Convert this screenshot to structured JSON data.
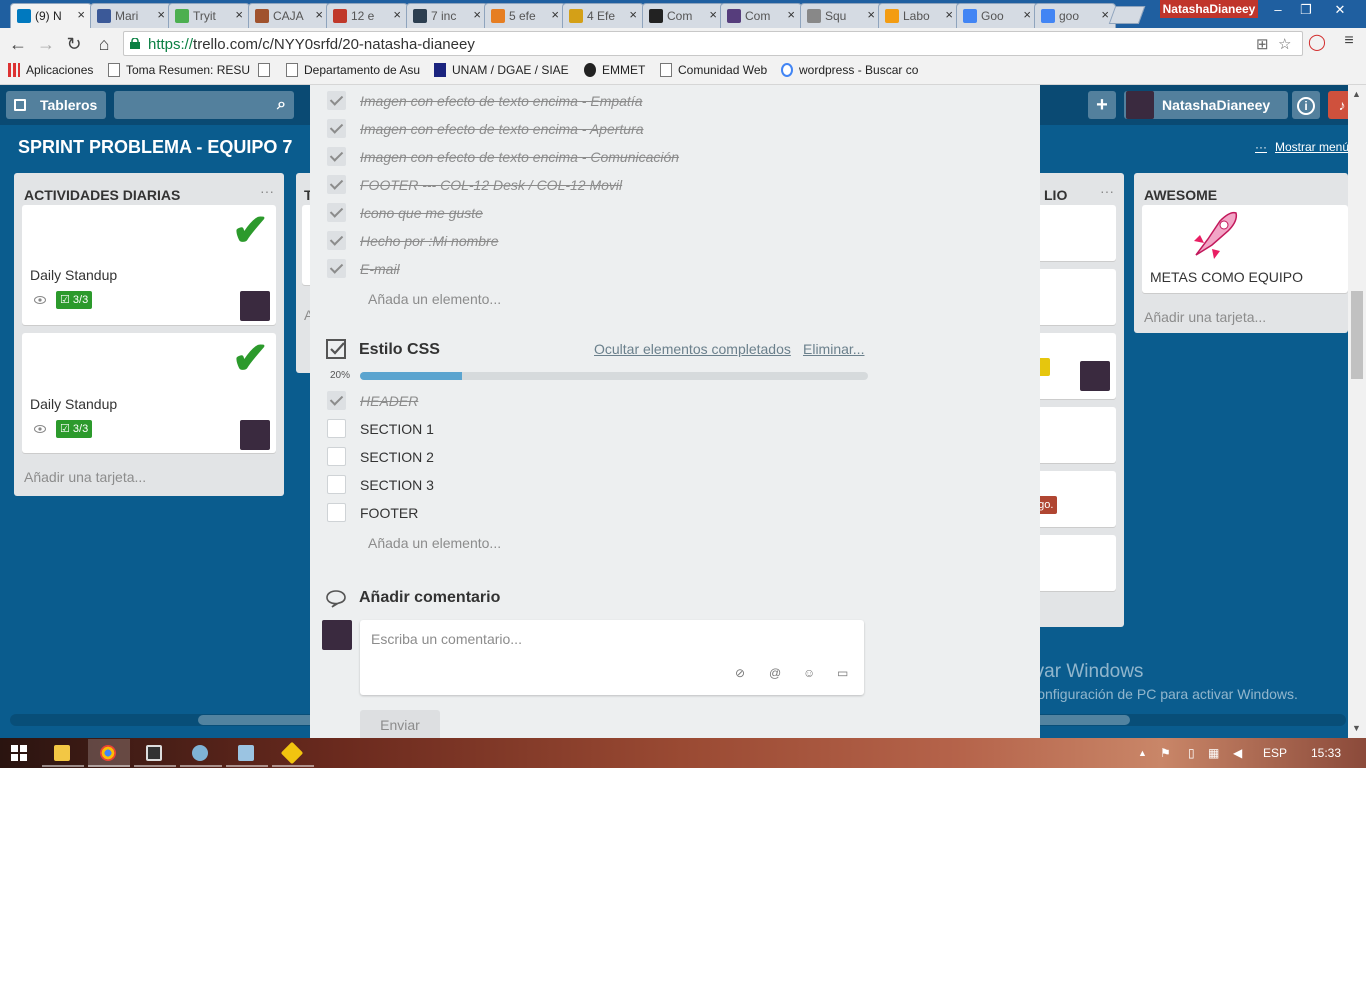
{
  "browser": {
    "tabs": [
      {
        "label": "(9) N",
        "favicon": "trello-icon",
        "color": "#0079bf",
        "active": true
      },
      {
        "label": "Mari",
        "favicon": "facebook-icon",
        "color": "#3b5998"
      },
      {
        "label": "Tryit",
        "favicon": "w3schools-icon",
        "color": "#4caf50"
      },
      {
        "label": "CAJA",
        "favicon": "page-icon",
        "color": "#a0522d"
      },
      {
        "label": "12 e",
        "favicon": "blob-icon",
        "color": "#c0392b"
      },
      {
        "label": "7 inc",
        "favicon": "mail-icon",
        "color": "#2c3e50"
      },
      {
        "label": "5 efe",
        "favicon": "swirl-icon",
        "color": "#e67e22"
      },
      {
        "label": "4 Efe",
        "favicon": "smiley-icon",
        "color": "#d4a017"
      },
      {
        "label": "Com",
        "favicon": "github-icon",
        "color": "#222222"
      },
      {
        "label": "Com",
        "favicon": "bootstrap-icon",
        "color": "#563d7c"
      },
      {
        "label": "Squ",
        "favicon": "page-icon",
        "color": "#888888"
      },
      {
        "label": "Labo",
        "favicon": "code-icon",
        "color": "#f39c12"
      },
      {
        "label": "Goo",
        "favicon": "google-icon",
        "color": "#4285f4"
      },
      {
        "label": "goo",
        "favicon": "google-icon",
        "color": "#4285f4"
      }
    ],
    "close_glyph": "×",
    "user": "NatashaDianeey",
    "url_protocol": "https://",
    "url_rest": "trello.com/c/NYY0srfd/20-natasha-dianeey",
    "bookmarks": [
      {
        "label": "Aplicaciones",
        "icon": "apps-icon"
      },
      {
        "label": "Toma Resumen: RESU",
        "icon": "page-icon"
      },
      {
        "label": "",
        "icon": "page-icon"
      },
      {
        "label": "Departamento de Asu",
        "icon": "page-icon"
      },
      {
        "label": "UNAM / DGAE / SIAE",
        "icon": "unam-icon"
      },
      {
        "label": "EMMET",
        "icon": "emmet-icon"
      },
      {
        "label": "Comunidad Web",
        "icon": "page-icon"
      },
      {
        "label": "wordpress - Buscar co",
        "icon": "google-icon"
      }
    ]
  },
  "trello": {
    "header": {
      "boards_label": "Tableros",
      "user_name": "NatashaDianeey",
      "add_glyph": "+",
      "info_glyph": "i"
    },
    "board_title": "SPRINT PROBLEMA - EQUIPO 7",
    "menu_link": "Mostrar menú",
    "menu_dots": "···",
    "lists": [
      {
        "title": "ACTIVIDADES DIARIAS",
        "dots": "···",
        "cards": [
          {
            "title": "Daily Standup",
            "badge": "3/3"
          },
          {
            "title": "Daily Standup",
            "badge": "3/3"
          }
        ],
        "add_card": "Añadir una tarjeta..."
      },
      {
        "title": "T",
        "add_card": "A"
      },
      {
        "title": "LIO",
        "dots": "···",
        "label_badge": "ago."
      },
      {
        "title": "AWESOME",
        "cards": [
          {
            "title": "METAS COMO EQUIPO"
          }
        ],
        "add_card": "Añadir una tarjeta..."
      }
    ]
  },
  "modal": {
    "checklist1": {
      "items": [
        {
          "text": "Imagen con efecto de texto encima - Empatía ",
          "done": true
        },
        {
          "text": "Imagen con efecto de texto encima - Apertura ",
          "done": true
        },
        {
          "text": "Imagen con efecto de texto encima - Comunicación ",
          "done": true
        },
        {
          "text": "FOOTER --- COL-12 Desk / COL-12 Movil ",
          "done": true
        },
        {
          "text": "Icono que me guste",
          "done": true
        },
        {
          "text": "Hecho por :Mi nombre",
          "done": true
        },
        {
          "text": "E-mail",
          "done": true
        }
      ],
      "add_item": "Añada un elemento..."
    },
    "checklist2": {
      "title": "Estilo CSS",
      "hide_completed": "Ocultar elementos completados",
      "delete": "Eliminar...",
      "progress_label": "20%",
      "progress": 0.2,
      "items": [
        {
          "text": "HEADER",
          "done": true
        },
        {
          "text": "SECTION 1",
          "done": false
        },
        {
          "text": "SECTION 2",
          "done": false
        },
        {
          "text": "SECTION 3",
          "done": false
        },
        {
          "text": "FOOTER",
          "done": false
        }
      ],
      "add_item": "Añada un elemento..."
    },
    "comment": {
      "title": "Añadir comentario",
      "placeholder": "Escriba un comentario...",
      "tools": [
        {
          "icon": "attachment-icon",
          "glyph": "⊘"
        },
        {
          "icon": "mention-icon",
          "glyph": "@"
        },
        {
          "icon": "emoji-icon",
          "glyph": "☺"
        },
        {
          "icon": "card-icon",
          "glyph": "▭"
        }
      ],
      "send": "Enviar"
    }
  },
  "watermark": {
    "line1": "Activar Windows",
    "line2": "Ir a Configuración de PC para activar Windows."
  },
  "taskbar": {
    "lang": "ESP",
    "time": "15:33"
  }
}
